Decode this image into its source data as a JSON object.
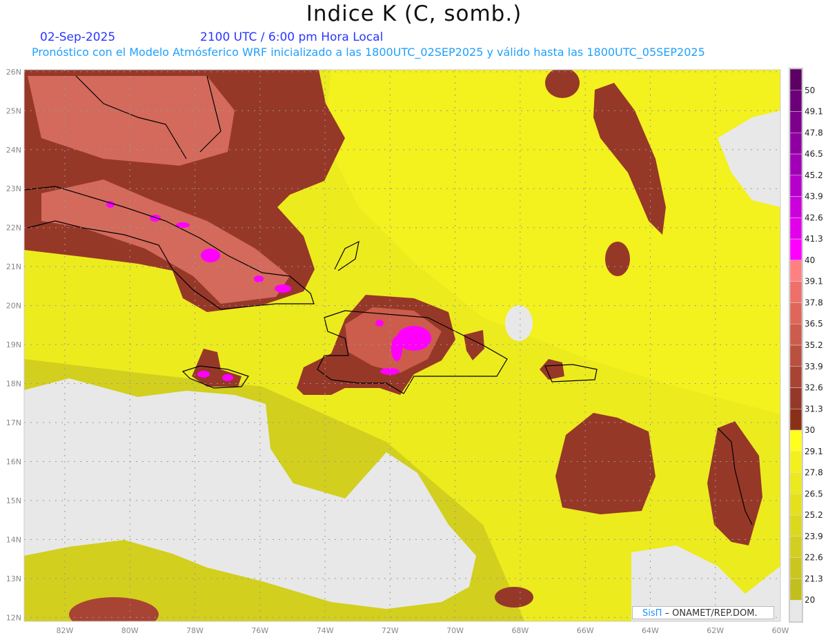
{
  "header": {
    "title": "Indice K (C, somb.)",
    "date": "02-Sep-2025",
    "time": "2100 UTC / 6:00 pm Hora Local",
    "subtitle": "Pronóstico con el Modelo Atmósferico WRF inicializado a las 1800UTC_02SEP2025 y válido hasta las  1800UTC_05SEP2025"
  },
  "map": {
    "lon_labels": [
      "82W",
      "80W",
      "78W",
      "76W",
      "74W",
      "72W",
      "70W",
      "68W",
      "66W",
      "64W",
      "62W",
      "60W"
    ],
    "lat_labels": [
      "26N",
      "25N",
      "24N",
      "23N",
      "22N",
      "21N",
      "20N",
      "19N",
      "18N",
      "17N",
      "16N",
      "15N",
      "14N",
      "13N",
      "12N"
    ],
    "extent": {
      "lon": [
        -83.25,
        -60
      ],
      "lat": [
        11.9,
        26.05
      ]
    }
  },
  "colorbar": {
    "labels": [
      "50",
      "49.1",
      "47.8",
      "46.5",
      "45.2",
      "43.9",
      "42.6",
      "41.3",
      "40",
      "39.1",
      "37.8",
      "36.5",
      "35.2",
      "33.9",
      "32.6",
      "31.3",
      "30",
      "29.1",
      "27.8",
      "26.5",
      "25.2",
      "23.9",
      "22.6",
      "21.3",
      "20"
    ],
    "colors": [
      "#5c0064",
      "#6c0078",
      "#7c008c",
      "#8e00a2",
      "#a200b6",
      "#b600ca",
      "#cc00dc",
      "#e200ea",
      "#ff00ff",
      "#ff8080",
      "#ee7068",
      "#de665a",
      "#cc5c4c",
      "#ba5040",
      "#a84434",
      "#963828",
      "#8a3018",
      "#ffff1c",
      "#f4f01e",
      "#ece91e",
      "#e4e11c",
      "#dcd81e",
      "#d3cf1e",
      "#cac61e",
      "#c1be1e",
      "#e8e8e8"
    ]
  },
  "credit": {
    "logo": "SisΠ",
    "text": " –  ONAMET/REP.DOM."
  }
}
